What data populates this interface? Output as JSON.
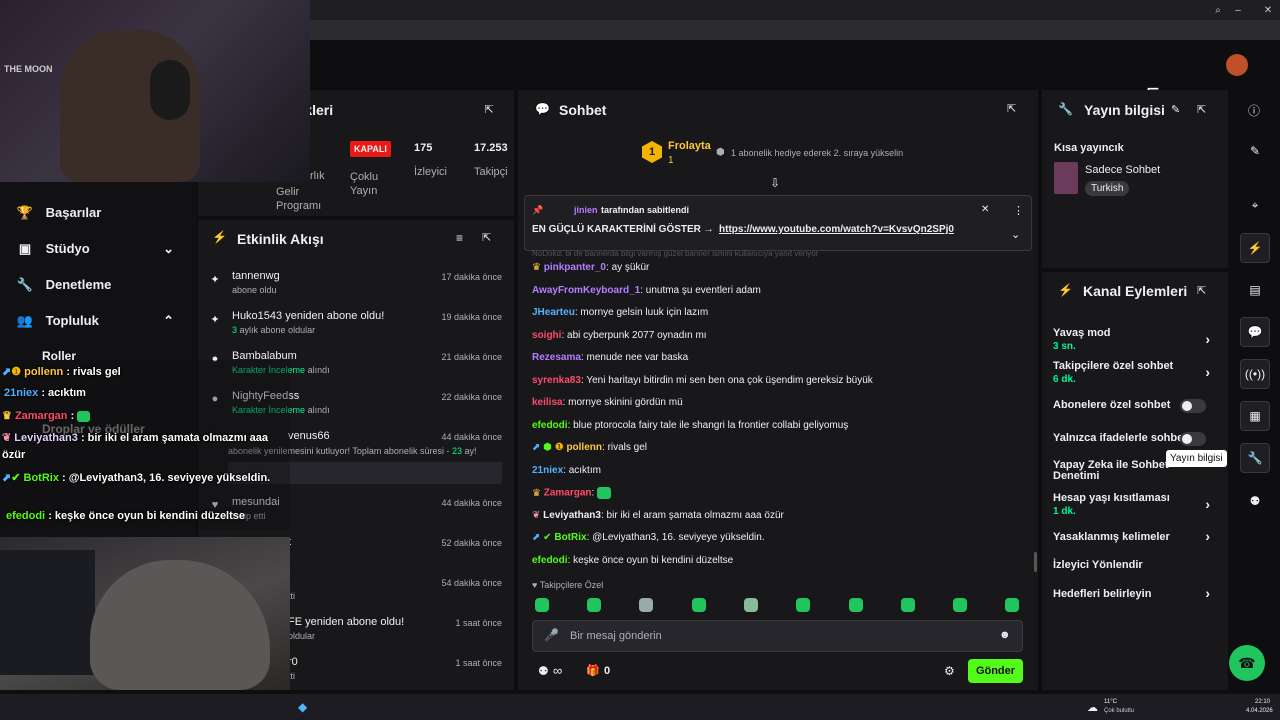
{
  "colors": {
    "accent_green": "#00f593",
    "send_green": "#53fc18",
    "badge_red": "#e91916",
    "bg": "#0e0e10",
    "panel": "#18181b"
  },
  "stats": {
    "header_title": "stikleri",
    "live_badge": "KAPALI",
    "items": [
      {
        "label": "Gelir Programı",
        "extra": "rlık"
      },
      {
        "label": "Çoklu Yayın",
        "value": "KAPALI"
      },
      {
        "label": "İzleyici",
        "value": "175"
      },
      {
        "label": "Takipçi",
        "value": "17.253"
      }
    ]
  },
  "sidebar": {
    "items": [
      {
        "label": "Başarılar",
        "icon": "trophy-icon"
      },
      {
        "label": "Stüdyo",
        "icon": "studio-icon"
      },
      {
        "label": "Denetleme",
        "icon": "wrench-icon"
      },
      {
        "label": "Topluluk",
        "icon": "community-icon"
      },
      {
        "label": "Roller"
      },
      {
        "label": "Droplar ve ödüller"
      }
    ]
  },
  "activity": {
    "title": "Etkinlik Akışı",
    "items": [
      {
        "title": "tannenwg",
        "sub": "abone oldu",
        "time": "17 dakika önce"
      },
      {
        "title": "Huko1543 yeniden abone oldu!",
        "sub_green": "3",
        "sub": "aylık abone oldular",
        "time": "19 dakika önce"
      },
      {
        "title": "Bambalabum",
        "sub_green": "Karakter İnceleme",
        "sub": "alındı",
        "time": "21 dakika önce"
      },
      {
        "title": "NightyFeedss",
        "sub_green": "Karakter İnceleme",
        "sub": "alındı",
        "time": "22 dakika önce"
      },
      {
        "title": "venus66",
        "sub": "abonelik yenilemesini kutluyor! Toplam abonelik süresi -",
        "sub_green": "23",
        "sub2": "ay!",
        "time": "44 dakika önce"
      },
      {
        "title": "mesundai",
        "sub": "takip etti",
        "time": "44 dakika önce"
      },
      {
        "title": "t",
        "time": "52 dakika önce"
      },
      {
        "title": "",
        "sub": "tti",
        "time": "54 dakika önce"
      },
      {
        "title": "FE yeniden abone oldu!",
        "sub": "oldular",
        "time": "1 saat önce"
      },
      {
        "title": "r0",
        "sub": "tti",
        "time": "1 saat önce"
      }
    ]
  },
  "chat": {
    "title": "Sohbet",
    "top_gifter": {
      "rank": "1",
      "name": "Frolayta",
      "count": "1",
      "note": "1 abonelik hediye ederek 2. sıraya yükselin"
    },
    "pinned": {
      "by": "jinien",
      "by_suffix": "tarafından sabitlendi",
      "message": "EN GÜÇLÜ KARAKTERİNİ GÖSTER →",
      "link": "https://www.youtube.com/watch?v=KvsvQn2SPj0"
    },
    "reply_hint": "NoDokd: bi de bannerda bilgi varmış güzel banner ismini kullanıcıya yanıt veriyor",
    "messages": [
      {
        "user": "pinkpanter_0",
        "color": "#b57dff",
        "text": "ay şükür"
      },
      {
        "user": "AwayFromKeyboard_1",
        "color": "#b57dff",
        "text": "unutma şu eventleri adam"
      },
      {
        "user": "JHearteu",
        "color": "#4fb3ff",
        "text": "mornye gelsin luuk için lazım"
      },
      {
        "user": "soighi",
        "color": "#ff4a6a",
        "text": "abi cyberpunk 2077 oynadın mı"
      },
      {
        "user": "Rezesama",
        "color": "#b57dff",
        "text": "menude nee var baska"
      },
      {
        "user": "syrenka83",
        "color": "#ff4a6a",
        "text": "Yeni haritayı bitirdin mi sen ben ona çok üşendim gereksiz büyük"
      },
      {
        "user": "keilisa",
        "color": "#ff4a6a",
        "text": "mornye skinini gördün mü"
      },
      {
        "user": "efedodi",
        "color": "#53fc18",
        "text": "blue ptorocola fairy tale ile shangri la frontier collabi geliyomuş"
      },
      {
        "user": "pollenn",
        "color": "#ffc83a",
        "text": "rivals gel"
      },
      {
        "user": "21niex",
        "color": "#4fb3ff",
        "text": "acıktım"
      },
      {
        "user": "Zamargan",
        "color": "#ff4a6a",
        "text": ""
      },
      {
        "user": "Leviyathan3",
        "color": "#efeff1",
        "text": "bir iki el aram şamata olmazmı aaa özür"
      },
      {
        "user": "BotRix",
        "color": "#53fc18",
        "text": "@Leviyathan3, 16. seviyeye yükseldin."
      },
      {
        "user": "efedodi",
        "color": "#53fc18",
        "text": "keşke önce oyun bi kendini düzeltse"
      }
    ],
    "followers_only": "Takipçilere Özel",
    "input_placeholder": "Bir mesaj gönderin",
    "points": "∞",
    "gift_count": "0",
    "send_label": "Gönder"
  },
  "stream_info": {
    "title": "Yayın bilgisi",
    "short_label": "Kısa yayıncık",
    "category": "Sadece Sohbet",
    "tag": "Turkish",
    "tooltip": "Yayın bilgisi"
  },
  "channel_actions": {
    "title": "Kanal Eylemleri",
    "items": [
      {
        "label": "Yavaş mod",
        "sub": "3 sn.",
        "kind": "chevron"
      },
      {
        "label": "Takipçilere özel sohbet",
        "sub": "6 dk.",
        "kind": "chevron"
      },
      {
        "label": "Abonelere özel sohbet",
        "kind": "toggle"
      },
      {
        "label": "Yalnızca ifadelerle sohbet",
        "kind": "toggle"
      },
      {
        "label": "Yapay Zeka ile Sohbet Denetimi",
        "kind": "external"
      },
      {
        "label": "Hesap yaşı kısıtlaması",
        "sub": "1 dk.",
        "kind": "chevron"
      },
      {
        "label": "Yasaklanmış kelimeler",
        "kind": "chevron"
      },
      {
        "label": "İzleyici Yönlendir",
        "kind": "none"
      },
      {
        "label": "Hedefleri belirleyin",
        "kind": "chevron"
      }
    ]
  },
  "overlay_chat": [
    {
      "user": "pollenn",
      "text": ": rivals gel"
    },
    {
      "user": "21niex",
      "text": ": acıktım"
    },
    {
      "user": "Zamargan",
      "text": ":"
    },
    {
      "user": "Leviyathan3",
      "text": ": bir iki el aram şamata olmazmı aaa özür"
    },
    {
      "user": "BotRix",
      "text": ": @Leviyathan3, 16. seviyeye yükseldin."
    },
    {
      "user": "efedodi",
      "text": ": keşke önce oyun bi kendini düzeltse"
    }
  ],
  "webcam": {
    "poster_text": "THE MOON"
  },
  "taskbar": {
    "weather_temp": "11°C",
    "weather_desc": "Çok bulutlu",
    "time": "22:10",
    "date": "4.04.2026"
  }
}
